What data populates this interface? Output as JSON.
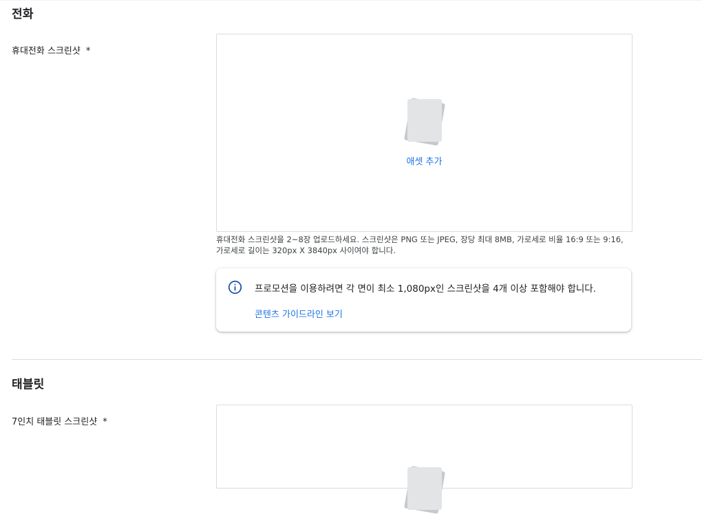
{
  "phone_section": {
    "title": "전화",
    "field_label": "휴대전화 스크린샷",
    "required_mark": "*",
    "add_asset_label": "애셋 추가",
    "hint": "휴대전화 스크린샷을 2~8장 업로드하세요. 스크린샷은 PNG 또는 JPEG, 장당 최대 8MB, 가로세로 비율 16:9 또는 9:16, 가로세로 길이는 320px X 3840px 사이여야 합니다.",
    "promo_text": "프로모션을 이용하려면 각 면이 최소 1,080px인 스크린샷을 4개 이상 포함해야 합니다.",
    "promo_link": "콘텐츠 가이드라인 보기",
    "info_icon": "info-icon"
  },
  "tablet_section": {
    "title": "태블릿",
    "field_label": "7인치 태블릿 스크린샷",
    "required_mark": "*"
  },
  "colors": {
    "link": "#1a73e8",
    "text": "#202124",
    "border": "#dadce0",
    "info_icon": "#174ea6"
  }
}
